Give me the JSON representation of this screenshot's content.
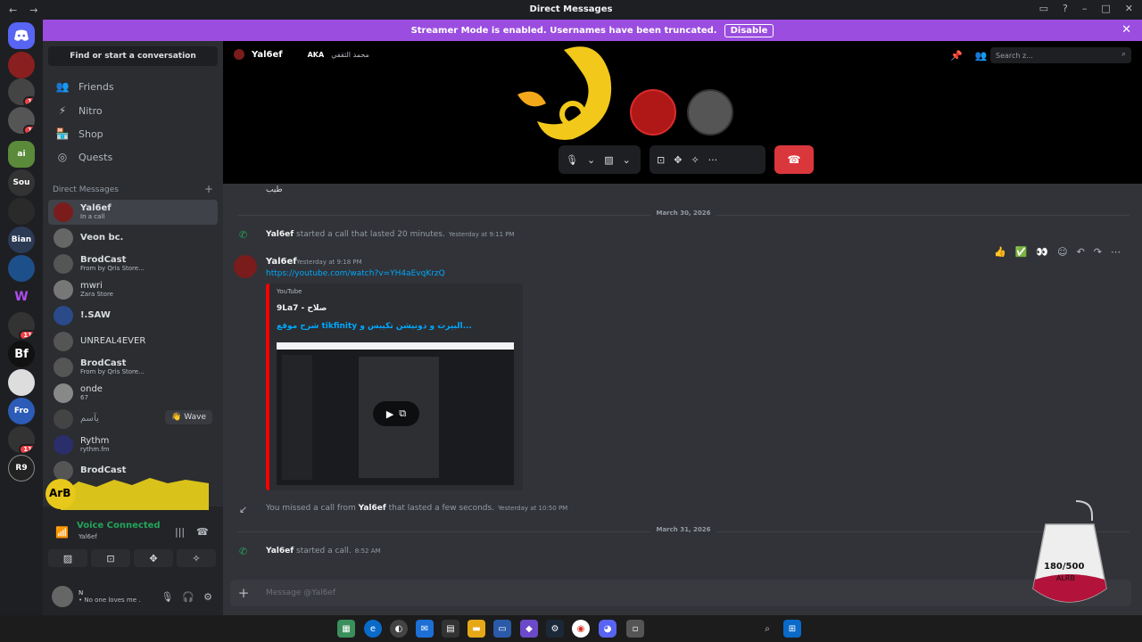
{
  "window": {
    "title": "Direct Messages",
    "nav": [
      "←",
      "→"
    ],
    "controls": [
      "▭",
      "?",
      "–",
      "□",
      "✕"
    ]
  },
  "banner": {
    "text": "Streamer Mode is enabled. Usernames have been truncated.",
    "disable_label": "Disable",
    "color": "#9b4de0"
  },
  "sidebar": {
    "find_label": "Find or start a conversation",
    "nav": [
      {
        "label": "Friends",
        "icon": "friends-icon"
      },
      {
        "label": "Nitro",
        "icon": "nitro-icon"
      },
      {
        "label": "Shop",
        "icon": "shop-icon"
      },
      {
        "label": "Quests",
        "icon": "quests-icon"
      }
    ],
    "dm_header": "Direct Messages",
    "dm_add": "+",
    "dms": [
      {
        "name": "Yal6ef",
        "sub": "In a call",
        "active": true
      },
      {
        "name": "Veon bc.",
        "sub": ""
      },
      {
        "name": "BrodCast",
        "sub": "From by Qris Store..."
      },
      {
        "name": "mwri",
        "sub": "Zara Store"
      },
      {
        "name": "!.SAW",
        "sub": ""
      },
      {
        "name": "UNREAL4EVER",
        "sub": ""
      },
      {
        "name": "BrodCast",
        "sub": "From by Qris Store..."
      },
      {
        "name": "onde",
        "sub": "67"
      },
      {
        "name": "يآسم",
        "sub": ""
      },
      {
        "name": "Rythm",
        "sub": "rythm.fm"
      },
      {
        "name": "BrodCast",
        "sub": ""
      }
    ],
    "wave_label": "Wave"
  },
  "voice": {
    "overlay_text": "ArB",
    "status": "Voice Connected",
    "sub": "Yal6ef",
    "user_name": "N",
    "user_status": "• No one loves me ."
  },
  "chat": {
    "recipient": "Yal6ef",
    "aka_label": "AKA",
    "aka_value": "محمد الثقفي",
    "search_placeholder": "Search z...",
    "small_msg": "طيب",
    "separators": [
      "March 30, 2026",
      "March 31, 2026"
    ],
    "call1": {
      "author": "Yal6ef",
      "text": " started a call that lasted 20 minutes.",
      "time": "Yesterday at 9:11 PM"
    },
    "message": {
      "author": "Yal6ef",
      "time": "Yesterday at 9:18 PM",
      "link": "https://youtube.com/watch?v=YH4aEvqKrzQ",
      "embed_provider": "YouTube",
      "embed_author": "9La7 - صلاح",
      "embed_title": "شرح موقع tikfinity البيرت و دونيشن تكيبس و..."
    },
    "missed": {
      "prefix": "You missed a call from ",
      "author": "Yal6ef",
      "suffix": " that lasted a few seconds.",
      "time": "Yesterday at 10:50 PM"
    },
    "call2": {
      "author": "Yal6ef",
      "text": " started a call.",
      "time": "8:52 AM"
    },
    "composer_placeholder": "Message @Yal6ef",
    "hover_reactions": [
      "👍",
      "✅",
      "👀"
    ]
  },
  "sticker": {
    "line1": "180/500",
    "line2": "ALRB"
  },
  "colors": {
    "accent": "#5865f2",
    "green": "#23a55a",
    "red": "#da373c",
    "link": "#00a8fc"
  }
}
